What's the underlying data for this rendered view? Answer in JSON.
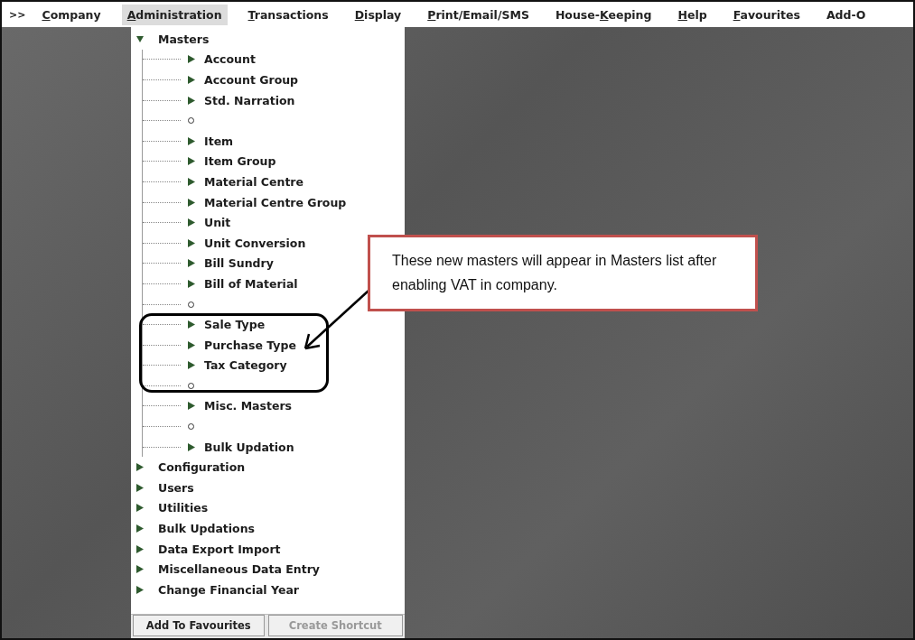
{
  "menu_bar": {
    "overflow": ">>",
    "items": [
      {
        "key": "C",
        "after": "ompany",
        "selected": false
      },
      {
        "key": "A",
        "after": "dministration",
        "selected": true
      },
      {
        "key": "T",
        "after": "ransactions",
        "selected": false
      },
      {
        "key": "D",
        "after": "isplay",
        "selected": false
      },
      {
        "key": "P",
        "after": "rint/Email/SMS",
        "selected": false
      },
      {
        "before": "House-",
        "key": "K",
        "after": "eeping",
        "selected": false
      },
      {
        "key": "H",
        "after": "elp",
        "selected": false
      },
      {
        "key": "F",
        "after": "avourites",
        "selected": false
      },
      {
        "before": "Add-O",
        "selected": false
      }
    ]
  },
  "menu_tree": [
    {
      "label": "Masters",
      "expanded": true,
      "children": [
        {
          "kind": "item",
          "label": "Account"
        },
        {
          "kind": "item",
          "label": "Account Group"
        },
        {
          "kind": "item",
          "label": "Std. Narration"
        },
        {
          "kind": "separator"
        },
        {
          "kind": "item",
          "label": "Item"
        },
        {
          "kind": "item",
          "label": "Item Group"
        },
        {
          "kind": "item",
          "label": "Material Centre"
        },
        {
          "kind": "item",
          "label": "Material Centre Group"
        },
        {
          "kind": "item",
          "label": "Unit"
        },
        {
          "kind": "item",
          "label": "Unit Conversion"
        },
        {
          "kind": "item",
          "label": "Bill Sundry"
        },
        {
          "kind": "item",
          "label": "Bill of Material"
        },
        {
          "kind": "separator"
        },
        {
          "kind": "item",
          "label": "Sale Type"
        },
        {
          "kind": "item",
          "label": "Purchase Type"
        },
        {
          "kind": "item",
          "label": "Tax Category"
        },
        {
          "kind": "separator"
        },
        {
          "kind": "item",
          "label": "Misc. Masters"
        },
        {
          "kind": "separator"
        },
        {
          "kind": "item",
          "label": "Bulk Updation"
        }
      ]
    },
    {
      "label": "Configuration",
      "expanded": false
    },
    {
      "label": "Users",
      "expanded": false
    },
    {
      "label": "Utilities",
      "expanded": false
    },
    {
      "label": "Bulk Updations",
      "expanded": false
    },
    {
      "label": "Data Export Import",
      "expanded": false
    },
    {
      "label": "Miscellaneous Data Entry",
      "expanded": false
    },
    {
      "label": "Change Financial Year",
      "expanded": false
    }
  ],
  "buttons": [
    {
      "label": "Add To Favourites",
      "disabled": false
    },
    {
      "label": "Create Shortcut",
      "disabled": true
    }
  ],
  "callout": {
    "text": "These new masters will appear in Masters list after enabling VAT in company."
  }
}
